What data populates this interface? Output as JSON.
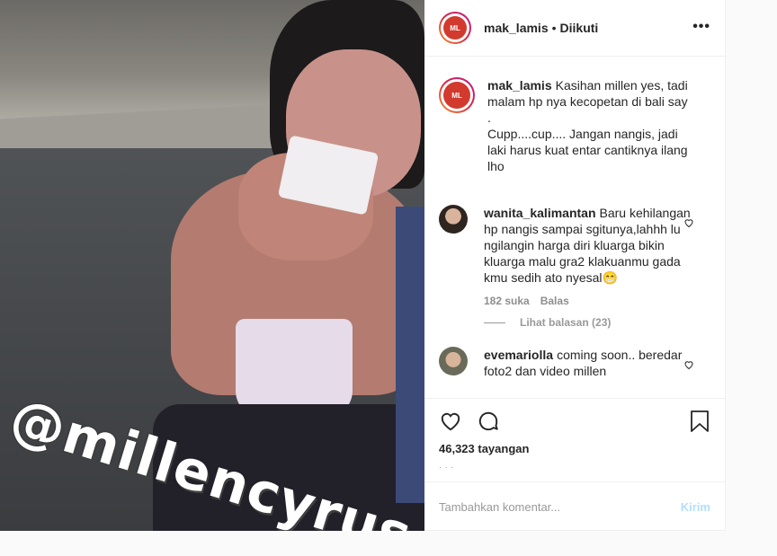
{
  "post": {
    "media_sticker": "@millencyrus",
    "author": "mak_lamis",
    "follow_status": "Diikuti",
    "separator": "•",
    "more_icon": "more-horizontal-icon"
  },
  "caption": {
    "user": "mak_lamis",
    "text": "Kasihan millen yes, tadi malam hp nya kecopetan di bali say\n.\nCupp....cup.... Jangan nangis, jadi laki harus kuat entar cantiknya ilang lho"
  },
  "comments": [
    {
      "user": "wanita_kalimantan",
      "text": "Baru kehilangan hp nangis sampai sgitunya,lahhh lu ngilangin harga diri kluarga bikin kluarga malu gra2 klakuanmu gada kmu sedih ato nyesal😁",
      "likes": "182 suka",
      "reply_label": "Balas",
      "view_replies": "Lihat balasan (23)"
    },
    {
      "user": "evemariolla",
      "text": "coming soon.. beredar foto2 dan video millen"
    }
  ],
  "actions": {
    "like_icon": "heart-icon",
    "comment_icon": "comment-icon",
    "save_icon": "bookmark-icon",
    "views": "46,323 tayangan"
  },
  "add_comment": {
    "placeholder": "Tambahkan komentar...",
    "send_label": "Kirim"
  },
  "colors": {
    "accent_send_disabled": "#b2dffc",
    "border": "#efefef",
    "text": "#262626",
    "muted": "#8e8e8e"
  }
}
